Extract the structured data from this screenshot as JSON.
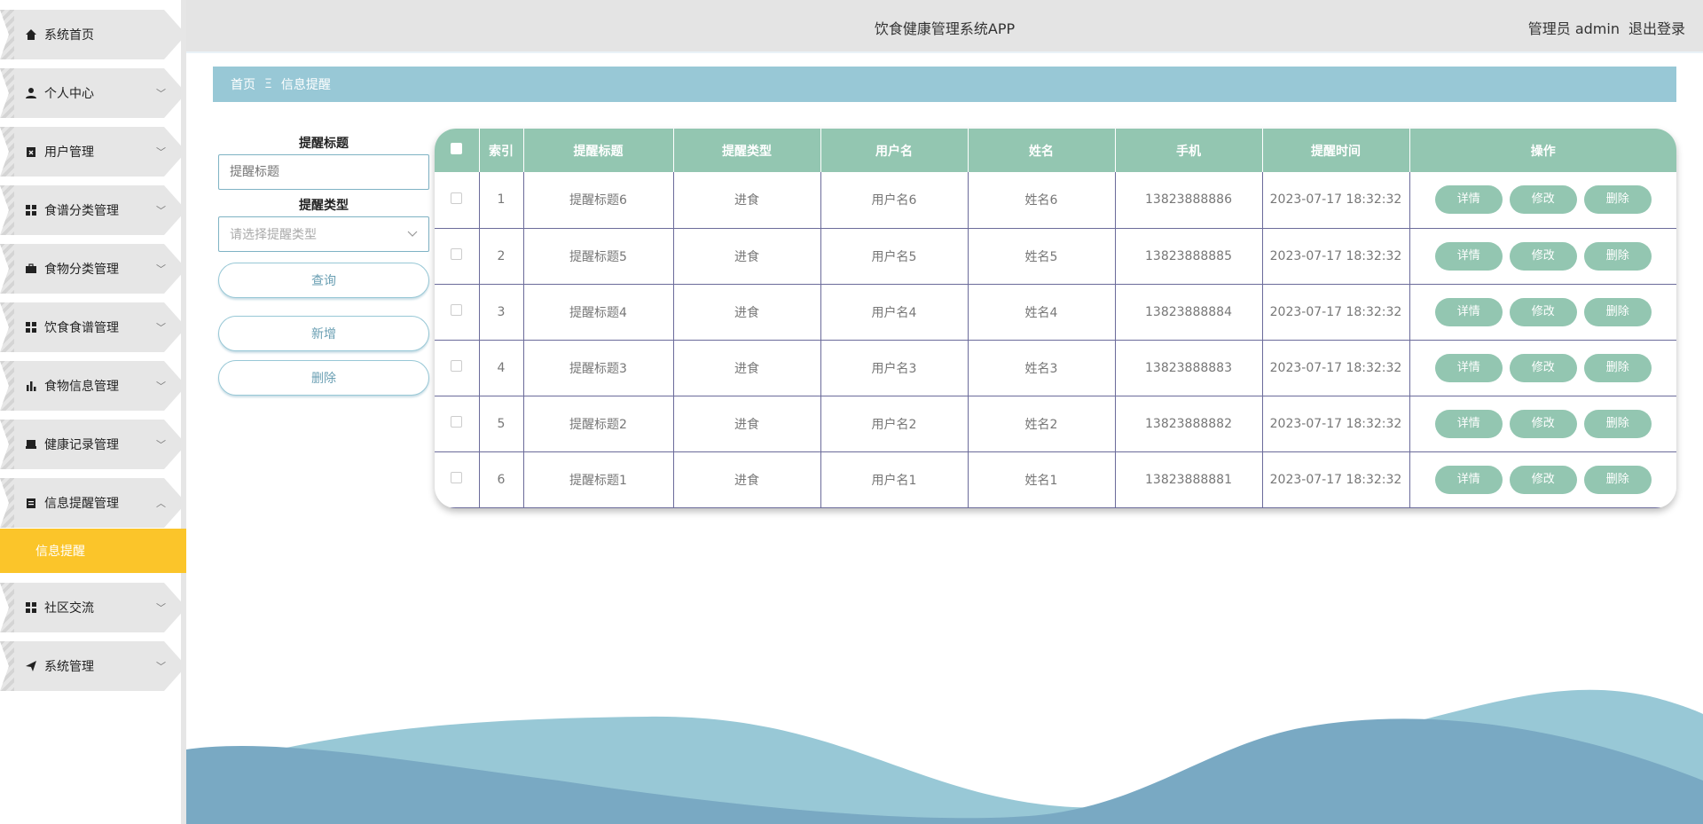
{
  "app": {
    "title": "饮食健康管理系统APP"
  },
  "header": {
    "user_label": "管理员 admin",
    "logout_label": "退出登录"
  },
  "sidebar": {
    "items": [
      {
        "label": "系统首页",
        "icon": "home-icon",
        "expanded": false,
        "has_children": false
      },
      {
        "label": "个人中心",
        "icon": "person-icon",
        "expanded": false,
        "has_children": true
      },
      {
        "label": "用户管理",
        "icon": "clipboard-x-icon",
        "expanded": false,
        "has_children": true
      },
      {
        "label": "食谱分类管理",
        "icon": "grid-icon",
        "expanded": false,
        "has_children": true
      },
      {
        "label": "食物分类管理",
        "icon": "briefcase-icon",
        "expanded": false,
        "has_children": true
      },
      {
        "label": "饮食食谱管理",
        "icon": "grid-icon",
        "expanded": false,
        "has_children": true
      },
      {
        "label": "食物信息管理",
        "icon": "bar-chart-icon",
        "expanded": false,
        "has_children": true
      },
      {
        "label": "健康记录管理",
        "icon": "printer-icon",
        "expanded": false,
        "has_children": true
      },
      {
        "label": "信息提醒管理",
        "icon": "clipboard-icon",
        "expanded": true,
        "has_children": true
      },
      {
        "label": "社区交流",
        "icon": "grid-icon",
        "expanded": false,
        "has_children": true
      },
      {
        "label": "系统管理",
        "icon": "send-icon",
        "expanded": false,
        "has_children": true
      }
    ],
    "active_sub": "信息提醒",
    "chevron_down": "﹀",
    "chevron_up": "︿"
  },
  "breadcrumb": {
    "home": "首页",
    "separator": "Ξ",
    "current": "信息提醒"
  },
  "search": {
    "title_label": "提醒标题",
    "title_placeholder": "提醒标题",
    "type_label": "提醒类型",
    "type_placeholder": "请选择提醒类型",
    "query_button": "查询",
    "add_button": "新增",
    "delete_button": "删除"
  },
  "table": {
    "columns": [
      "索引",
      "提醒标题",
      "提醒类型",
      "用户名",
      "姓名",
      "手机",
      "提醒时间",
      "操作"
    ],
    "rows": [
      {
        "index": "1",
        "title": "提醒标题6",
        "type": "进食",
        "username": "用户名6",
        "name": "姓名6",
        "phone": "13823888886",
        "time": "2023-07-17 18:32:32"
      },
      {
        "index": "2",
        "title": "提醒标题5",
        "type": "进食",
        "username": "用户名5",
        "name": "姓名5",
        "phone": "13823888885",
        "time": "2023-07-17 18:32:32"
      },
      {
        "index": "3",
        "title": "提醒标题4",
        "type": "进食",
        "username": "用户名4",
        "name": "姓名4",
        "phone": "13823888884",
        "time": "2023-07-17 18:32:32"
      },
      {
        "index": "4",
        "title": "提醒标题3",
        "type": "进食",
        "username": "用户名3",
        "name": "姓名3",
        "phone": "13823888883",
        "time": "2023-07-17 18:32:32"
      },
      {
        "index": "5",
        "title": "提醒标题2",
        "type": "进食",
        "username": "用户名2",
        "name": "姓名2",
        "phone": "13823888882",
        "time": "2023-07-17 18:32:32"
      },
      {
        "index": "6",
        "title": "提醒标题1",
        "type": "进食",
        "username": "用户名1",
        "name": "姓名1",
        "phone": "13823888881",
        "time": "2023-07-17 18:32:32"
      }
    ],
    "actions": {
      "detail": "详情",
      "edit": "修改",
      "delete": "删除"
    }
  },
  "colors": {
    "accent": "#93c6b1",
    "breadcrumb": "#98c8d6",
    "active_menu": "#fbc52a",
    "wave_light": "#98c8d6",
    "wave_dark": "#79a9c3"
  }
}
